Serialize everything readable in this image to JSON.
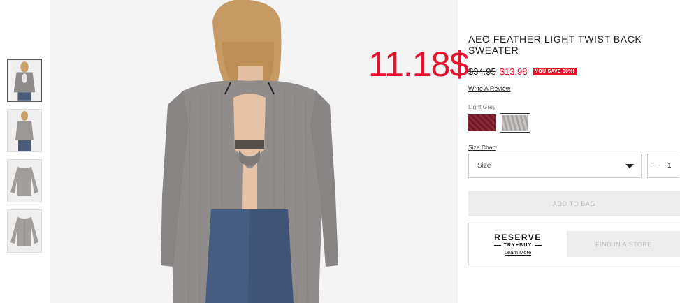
{
  "overlay_price": "11.18$",
  "product": {
    "title": "AEO FEATHER LIGHT TWIST BACK SWEATER",
    "old_price": "$34.95",
    "new_price": "$13.98",
    "save_badge": "YOU SAVE 60%!",
    "review_link": "Write A Review",
    "color_name": "Light Grey",
    "size_chart": "Size Chart",
    "size_placeholder": "Size",
    "qty_minus": "−",
    "qty_value": "1",
    "add_to_bag": "ADD TO BAG",
    "reserve": {
      "line1": "RESERVE",
      "line2": "TRY+BUY",
      "learn_more": "Learn More",
      "find_store": "FIND IN A STORE"
    }
  },
  "colors": {
    "accent_red": "#e8112d",
    "swatch_red": "#7a1f2c",
    "swatch_grey": "#b9b5b2"
  },
  "thumbnails": [
    {
      "icon": "sweater-back-thumbnail",
      "active": true
    },
    {
      "icon": "sweater-front-thumbnail",
      "active": false
    },
    {
      "icon": "sweater-flat-front-thumbnail",
      "active": false
    },
    {
      "icon": "sweater-flat-back-thumbnail",
      "active": false
    }
  ]
}
